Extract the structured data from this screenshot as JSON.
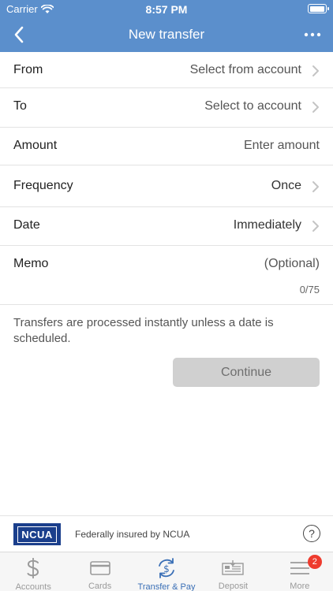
{
  "status_bar": {
    "carrier": "Carrier",
    "time": "8:57 PM"
  },
  "header": {
    "title": "New transfer",
    "back_icon": "chevron-left-icon",
    "more_icon": "more-horizontal-icon"
  },
  "form": {
    "rows": [
      {
        "label": "From",
        "value": "Select from account",
        "chevron": true
      },
      {
        "label": "To",
        "value": "Select to account",
        "chevron": true
      },
      {
        "label": "Amount",
        "placeholder": "Enter amount",
        "chevron": false
      },
      {
        "label": "Frequency",
        "value": "Once",
        "chevron": true
      },
      {
        "label": "Date",
        "value": "Immediately",
        "chevron": true
      },
      {
        "label": "Memo",
        "placeholder": "(Optional)",
        "counter": "0/75",
        "chevron": false
      }
    ]
  },
  "notice": "Transfers are processed instantly unless a date is scheduled.",
  "continue_label": "Continue",
  "insurance": {
    "logo_text": "NCUA",
    "text": "Federally insured by NCUA",
    "help_label": "?"
  },
  "tabs": [
    {
      "label": "Accounts",
      "icon": "dollar-icon",
      "active": false
    },
    {
      "label": "Cards",
      "icon": "card-icon",
      "active": false
    },
    {
      "label": "Transfer & Pay",
      "icon": "transfer-icon",
      "active": true
    },
    {
      "label": "Deposit",
      "icon": "check-deposit-icon",
      "active": false
    },
    {
      "label": "More",
      "icon": "menu-icon",
      "active": false,
      "badge": "2"
    }
  ],
  "colors": {
    "header_bg": "#5b8fcc",
    "active_tab": "#3a6fb6",
    "badge": "#ee3b2e",
    "button_disabled": "#d0d0d0"
  }
}
